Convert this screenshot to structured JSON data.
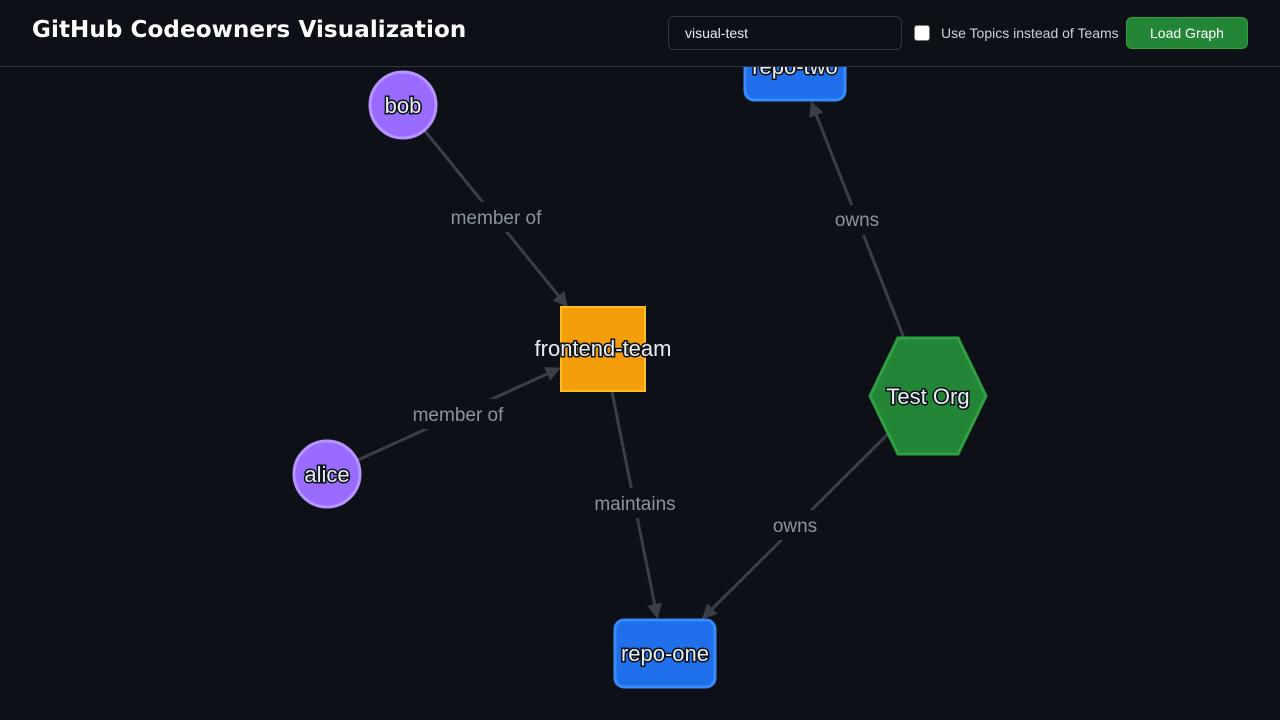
{
  "header": {
    "title": "GitHub Codeowners Visualization",
    "org_input_value": "visual-test",
    "topics_label": "Use Topics instead of Teams",
    "topics_checked": false,
    "load_label": "Load Graph"
  },
  "graph": {
    "nodes": {
      "bob": {
        "label": "bob",
        "kind": "user",
        "color": "#9a6bff"
      },
      "alice": {
        "label": "alice",
        "kind": "user",
        "color": "#9a6bff"
      },
      "frontend_team": {
        "label": "frontend-team",
        "kind": "team",
        "color": "#f59e0b"
      },
      "test_org": {
        "label": "Test Org",
        "kind": "org",
        "color": "#238636"
      },
      "repo_one": {
        "label": "repo-one",
        "kind": "repo",
        "color": "#1f6feb"
      },
      "repo_two": {
        "label": "repo-two",
        "kind": "repo",
        "color": "#1f6feb"
      }
    },
    "edges": [
      {
        "from": "bob",
        "to": "frontend_team",
        "label": "member of"
      },
      {
        "from": "alice",
        "to": "frontend_team",
        "label": "member of"
      },
      {
        "from": "frontend_team",
        "to": "repo_one",
        "label": "maintains"
      },
      {
        "from": "test_org",
        "to": "repo_two",
        "label": "owns"
      },
      {
        "from": "test_org",
        "to": "repo_one",
        "label": "owns"
      }
    ]
  }
}
